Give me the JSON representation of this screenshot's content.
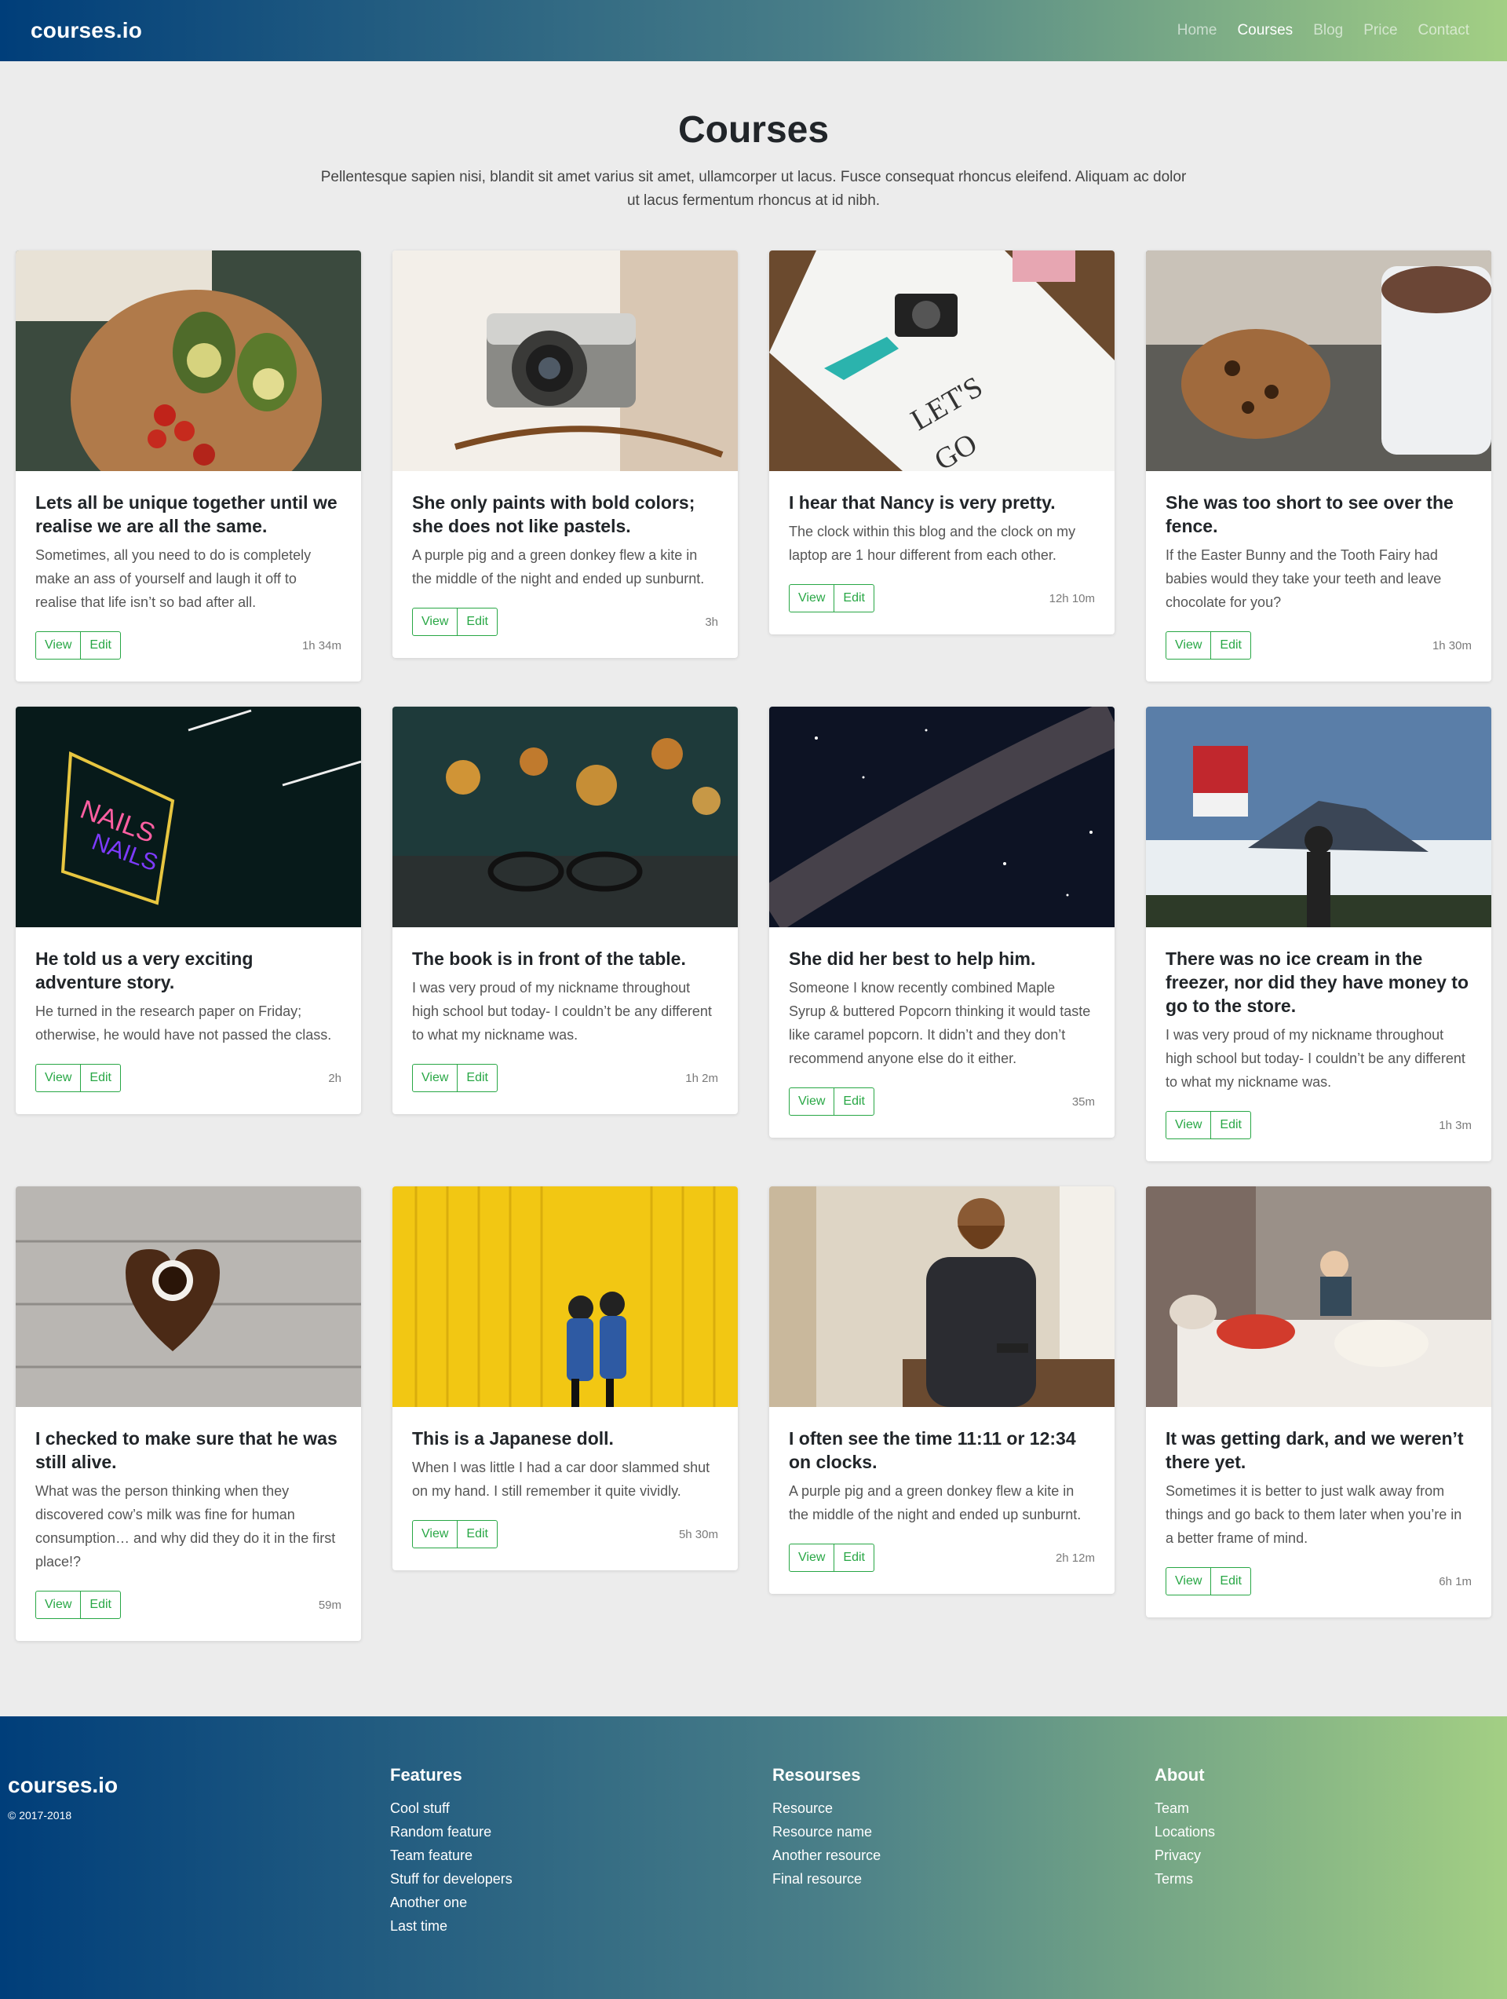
{
  "navbar": {
    "brand": "courses.io",
    "links": [
      "Home",
      "Courses",
      "Blog",
      "Price",
      "Contact"
    ],
    "active": "Courses"
  },
  "header": {
    "title": "Courses",
    "description": "Pellentesque sapien nisi, blandit sit amet varius sit amet, ullamcorper ut lacus. Fusce consequat rhoncus eleifend. Aliquam ac dolor ut lacus fermentum rhoncus at id nibh."
  },
  "courses": [
    {
      "title": "Lets all be unique together until we realise we are all the same.",
      "text": "Sometimes, all you need to do is completely make an ass of yourself and laugh it off to realise that life isn’t so bad after all.",
      "view": "View",
      "edit": "Edit",
      "duration": "1h 34m",
      "image": "food-avocado-photo"
    },
    {
      "title": "She only paints with bold colors; she does not like pastels.",
      "text": "A purple pig and a green donkey flew a kite in the middle of the night and ended up sunburnt.",
      "view": "View",
      "edit": "Edit",
      "duration": "3h",
      "image": "vintage-camera-photo"
    },
    {
      "title": "I hear that Nancy is very pretty.",
      "text": "The clock within this blog and the clock on my laptop are 1 hour different from each other.",
      "view": "View",
      "edit": "Edit",
      "duration": "12h 10m",
      "image": "travel-map-photo"
    },
    {
      "title": "She was too short to see over the fence.",
      "text": "If the Easter Bunny and the Tooth Fairy had babies would they take your teeth and leave chocolate for you?",
      "view": "View",
      "edit": "Edit",
      "duration": "1h 30m",
      "image": "cookies-cocoa-photo"
    },
    {
      "title": "He told us a very exciting adventure story.",
      "text": "He turned in the research paper on Friday; otherwise, he would have not passed the class.",
      "view": "View",
      "edit": "Edit",
      "duration": "2h",
      "image": "neon-sign-photo"
    },
    {
      "title": "The book is in front of the table.",
      "text": "I was very proud of my nickname throughout high school but today- I couldn’t be any different to what my nickname was.",
      "view": "View",
      "edit": "Edit",
      "duration": "1h 2m",
      "image": "glasses-bokeh-photo"
    },
    {
      "title": "She did her best to help him.",
      "text": "Someone I know recently combined Maple Syrup & buttered Popcorn thinking it would taste like caramel popcorn. It didn’t and they don’t recommend anyone else do it either.",
      "view": "View",
      "edit": "Edit",
      "duration": "35m",
      "image": "milky-way-photo"
    },
    {
      "title": "There was no ice cream in the freezer, nor did they have money to go to the store.",
      "text": "I was very proud of my nickname throughout high school but today- I couldn’t be any different to what my nickname was.",
      "view": "View",
      "edit": "Edit",
      "duration": "1h 3m",
      "image": "mountain-flag-photo"
    },
    {
      "title": "I checked to make sure that he was still alive.",
      "text": "What was the person thinking when they discovered cow’s milk was fine for human consumption… and why did they do it in the first place!?",
      "view": "View",
      "edit": "Edit",
      "duration": "59m",
      "image": "coffee-heart-photo"
    },
    {
      "title": "This is a Japanese doll.",
      "text": "When I was little I had a car door slammed shut on my hand. I still remember it quite vividly.",
      "view": "View",
      "edit": "Edit",
      "duration": "5h 30m",
      "image": "yellow-wall-girls-photo"
    },
    {
      "title": "I often see the time 11:11 or 12:34 on clocks.",
      "text": "A purple pig and a green donkey flew a kite in the middle of the night and ended up sunburnt.",
      "view": "View",
      "edit": "Edit",
      "duration": "2h 12m",
      "image": "man-phone-photo"
    },
    {
      "title": "It was getting dark, and we weren’t there yet.",
      "text": "Sometimes it is better to just walk away from things and go back to them later when you’re in a better frame of mind.",
      "view": "View",
      "edit": "Edit",
      "duration": "6h 1m",
      "image": "child-bedroom-photo"
    }
  ],
  "footer": {
    "brand": "courses.io",
    "copyright": "© 2017-2018",
    "columns": [
      {
        "heading": "Features",
        "links": [
          "Cool stuff",
          "Random feature",
          "Team feature",
          "Stuff for developers",
          "Another one",
          "Last time"
        ]
      },
      {
        "heading": "Resourses",
        "links": [
          "Resource",
          "Resource name",
          "Another resource",
          "Final resource"
        ]
      },
      {
        "heading": "About",
        "links": [
          "Team",
          "Locations",
          "Privacy",
          "Terms"
        ]
      }
    ]
  }
}
